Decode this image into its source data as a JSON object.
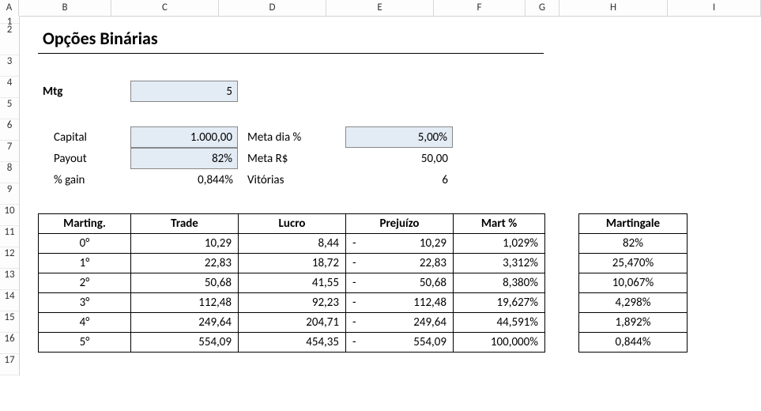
{
  "columns": [
    "A",
    "B",
    "C",
    "D",
    "E",
    "F",
    "G",
    "H",
    "I"
  ],
  "rows": [
    "1",
    "2",
    "3",
    "4",
    "5",
    "6",
    "7",
    "8",
    "9",
    "10",
    "11",
    "12",
    "13",
    "14",
    "15",
    "16",
    "17"
  ],
  "title": "Opções Binárias",
  "inputs": {
    "mtg_label": "Mtg",
    "mtg_value": "5",
    "capital_label": "Capital",
    "capital_value": "1.000,00",
    "payout_label": "Payout",
    "payout_value": "82%",
    "gain_label": "% gain",
    "gain_value": "0,844%",
    "meta_dia_label": "Meta dia %",
    "meta_dia_value": "5,00%",
    "meta_rs_label": "Meta R$",
    "meta_rs_value": "50,00",
    "vitorias_label": "Vitórias",
    "vitorias_value": "6"
  },
  "table": {
    "headers": {
      "marting": "Marting.",
      "trade": "Trade",
      "lucro": "Lucro",
      "prejuizo": "Prejuízo",
      "martpct": "Mart %"
    },
    "rows": [
      {
        "marting": "0°",
        "trade": "10,29",
        "lucro": "8,44",
        "prej": "10,29",
        "mpct": "1,029%"
      },
      {
        "marting": "1°",
        "trade": "22,83",
        "lucro": "18,72",
        "prej": "22,83",
        "mpct": "3,312%"
      },
      {
        "marting": "2°",
        "trade": "50,68",
        "lucro": "41,55",
        "prej": "50,68",
        "mpct": "8,380%"
      },
      {
        "marting": "3°",
        "trade": "112,48",
        "lucro": "92,23",
        "prej": "112,48",
        "mpct": "19,627%"
      },
      {
        "marting": "4°",
        "trade": "249,64",
        "lucro": "204,71",
        "prej": "249,64",
        "mpct": "44,591%"
      },
      {
        "marting": "5°",
        "trade": "554,09",
        "lucro": "454,35",
        "prej": "554,09",
        "mpct": "100,000%"
      }
    ]
  },
  "side": {
    "header": "Martingale",
    "rows": [
      "82%",
      "25,470%",
      "10,067%",
      "4,298%",
      "1,892%",
      "0,844%"
    ]
  },
  "glyphs": {
    "dash": "-"
  }
}
